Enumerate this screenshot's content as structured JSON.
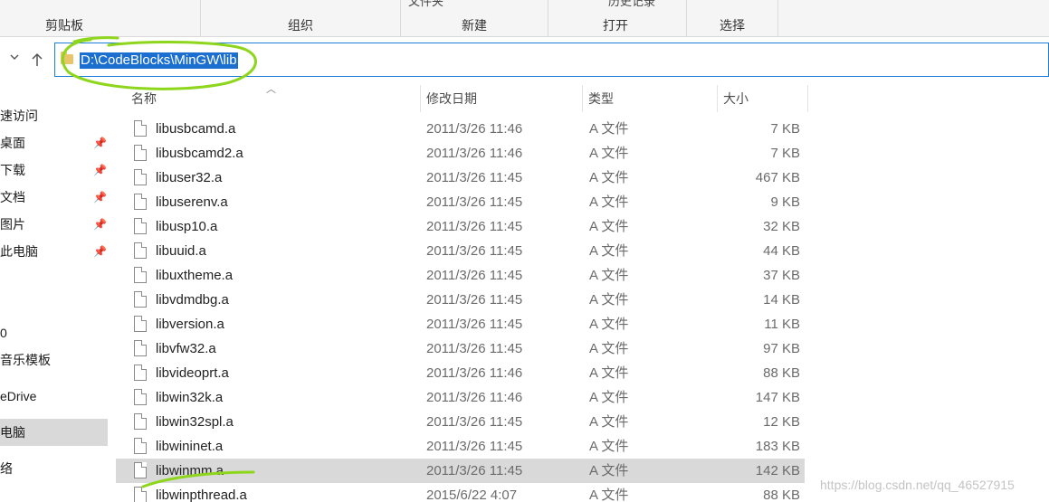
{
  "ribbon": {
    "groups": [
      {
        "label": "剪贴板"
      },
      {
        "label": "组织"
      },
      {
        "label": "新建",
        "partial_top": "文件夹"
      },
      {
        "label": "打开",
        "partial_top": "历史记录"
      },
      {
        "label": "选择"
      }
    ]
  },
  "nav": {
    "back_icon": "chevron-down-icon",
    "up_icon": "up-arrow-icon",
    "address": "D:\\CodeBlocks\\MinGW\\lib"
  },
  "sidebar": {
    "items": [
      {
        "label": "速访问"
      },
      {
        "label": "桌面",
        "pinned": true
      },
      {
        "label": "下载",
        "pinned": true
      },
      {
        "label": "文档",
        "pinned": true
      },
      {
        "label": "图片",
        "pinned": true
      },
      {
        "label": "此电脑",
        "pinned": true
      },
      {
        "label": "0"
      },
      {
        "label": "音乐模板"
      },
      {
        "label": "eDrive"
      },
      {
        "label": "电脑",
        "selected": true
      },
      {
        "label": "络"
      }
    ]
  },
  "columns": {
    "name": "名称",
    "date": "修改日期",
    "type": "类型",
    "size": "大小"
  },
  "files": [
    {
      "name": "libusbcamd.a",
      "date": "2011/3/26 11:46",
      "type": "A 文件",
      "size": "7 KB"
    },
    {
      "name": "libusbcamd2.a",
      "date": "2011/3/26 11:46",
      "type": "A 文件",
      "size": "7 KB"
    },
    {
      "name": "libuser32.a",
      "date": "2011/3/26 11:45",
      "type": "A 文件",
      "size": "467 KB"
    },
    {
      "name": "libuserenv.a",
      "date": "2011/3/26 11:45",
      "type": "A 文件",
      "size": "9 KB"
    },
    {
      "name": "libusp10.a",
      "date": "2011/3/26 11:45",
      "type": "A 文件",
      "size": "32 KB"
    },
    {
      "name": "libuuid.a",
      "date": "2011/3/26 11:45",
      "type": "A 文件",
      "size": "44 KB"
    },
    {
      "name": "libuxtheme.a",
      "date": "2011/3/26 11:45",
      "type": "A 文件",
      "size": "37 KB"
    },
    {
      "name": "libvdmdbg.a",
      "date": "2011/3/26 11:45",
      "type": "A 文件",
      "size": "14 KB"
    },
    {
      "name": "libversion.a",
      "date": "2011/3/26 11:45",
      "type": "A 文件",
      "size": "11 KB"
    },
    {
      "name": "libvfw32.a",
      "date": "2011/3/26 11:45",
      "type": "A 文件",
      "size": "97 KB"
    },
    {
      "name": "libvideoprt.a",
      "date": "2011/3/26 11:46",
      "type": "A 文件",
      "size": "88 KB"
    },
    {
      "name": "libwin32k.a",
      "date": "2011/3/26 11:46",
      "type": "A 文件",
      "size": "147 KB"
    },
    {
      "name": "libwin32spl.a",
      "date": "2011/3/26 11:45",
      "type": "A 文件",
      "size": "12 KB"
    },
    {
      "name": "libwininet.a",
      "date": "2011/3/26 11:45",
      "type": "A 文件",
      "size": "183 KB"
    },
    {
      "name": "libwinmm.a",
      "date": "2011/3/26 11:45",
      "type": "A 文件",
      "size": "142 KB",
      "selected": true
    },
    {
      "name": "libwinpthread.a",
      "date": "2015/6/22 4:07",
      "type": "A 文件",
      "size": "88 KB"
    }
  ],
  "watermark": "https://blog.csdn.net/qq_46527915",
  "colors": {
    "selection": "#d9d9d9",
    "address_highlight": "#1a6fd1",
    "annotation": "#8ed61c"
  }
}
